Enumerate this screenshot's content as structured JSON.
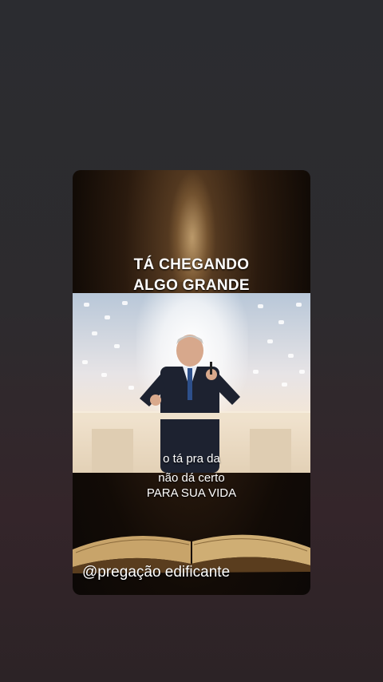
{
  "overlay": {
    "title_line1": "TÁ CHEGANDO",
    "title_line2": "ALGO GRANDE"
  },
  "captions": {
    "line1": "o tá pra da",
    "line2": "não dá certo",
    "line3": "PARA SUA VIDA"
  },
  "channel": {
    "handle": "@pregação edificante"
  }
}
